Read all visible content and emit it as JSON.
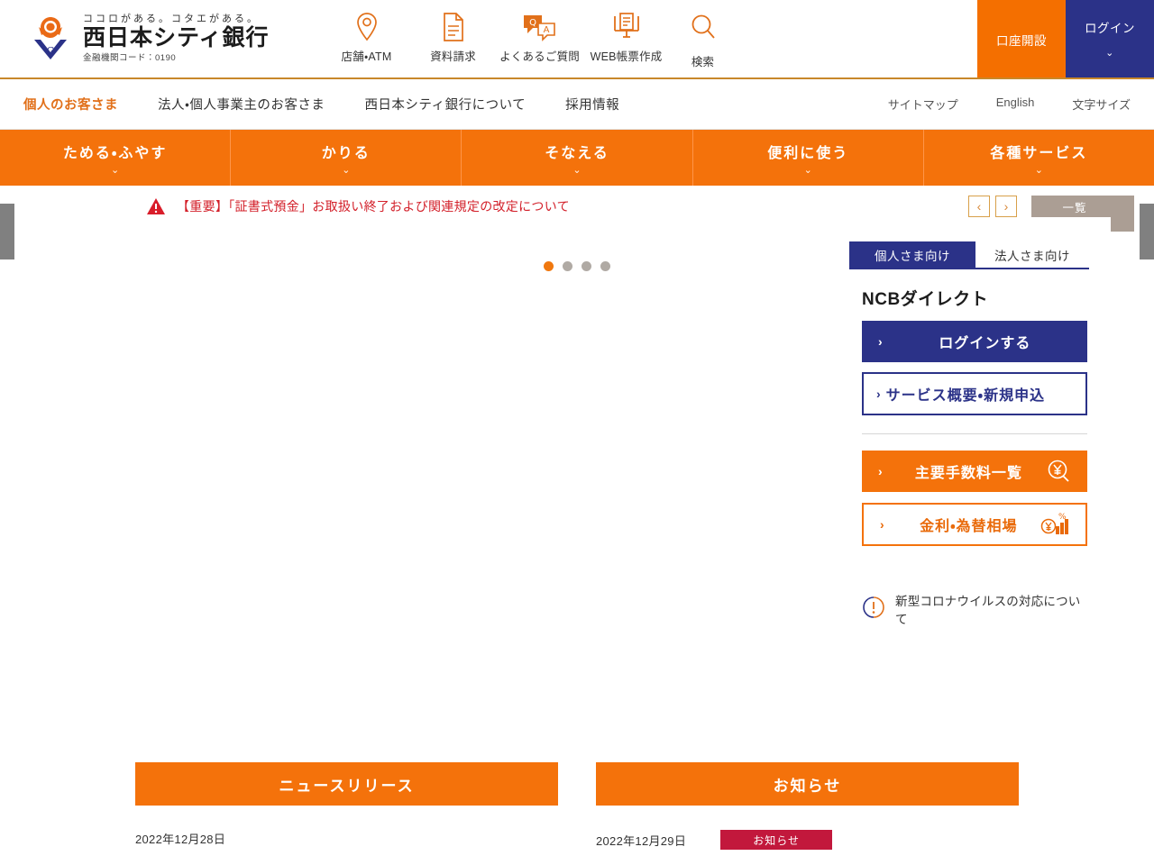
{
  "brand": {
    "tagline": "ココロがある。コタエがある。",
    "name": "西日本シティ銀行",
    "code": "金融機関コード：0190",
    "logo_icon": "flower-v-logo"
  },
  "header": {
    "icons": [
      {
        "label": "店舗・ATM",
        "icon": "map-pin-icon"
      },
      {
        "label": "資料請求",
        "icon": "document-icon"
      },
      {
        "label": "よくあるご質問",
        "icon": "qa-bubble-icon"
      },
      {
        "label": "WEB帳票作成",
        "icon": "web-form-icon"
      },
      {
        "label": "検索",
        "icon": "search-icon"
      }
    ],
    "cta_open_account": "口座開設",
    "cta_login": "ログイン",
    "cta_login_chevron": "⌄"
  },
  "gnav": {
    "items": [
      {
        "label": "個人のお客さま",
        "active": true
      },
      {
        "label": "法人・個人事業主のお客さま",
        "active": false
      },
      {
        "label": "西日本シティ銀行について",
        "active": false
      },
      {
        "label": "採用情報",
        "active": false
      }
    ],
    "utils": [
      "サイトマップ",
      "English",
      "文字サイズ"
    ]
  },
  "meganav": {
    "chevron": "⌄",
    "items": [
      "ためる・ふやす",
      "かりる",
      "そなえる",
      "便利に使う",
      "各種サービス"
    ]
  },
  "notice": {
    "warn_icon": "warning-triangle-icon",
    "text": "【重要】「証書式預金」お取扱い終了および関連規定の改定について",
    "prev": "‹",
    "next": "›",
    "list_label": "一覧"
  },
  "carousel": {
    "dot_count": 4,
    "active_index": 0
  },
  "sidepanel": {
    "tabs": [
      {
        "label": "個人さま向け",
        "active": true
      },
      {
        "label": "法人さま向け",
        "active": false
      }
    ],
    "title": "NCBダイレクト",
    "arrow": "›",
    "login_button": "ログインする",
    "service_button": "サービス概要・新規申込",
    "fees_button": "主要手数料一覧",
    "fees_icon": "yen-magnifier-icon",
    "rates_button": "金利・為替相場",
    "rates_icon": "yen-percent-chart-icon",
    "covid_icon": "exclamation-circle-icon",
    "covid_label": "新型コロナウイルスの対応について"
  },
  "news": {
    "columns": [
      {
        "heading": "ニュースリリース",
        "items": [
          {
            "date": "2022年12月28日",
            "badge": null
          }
        ]
      },
      {
        "heading": "お知らせ",
        "items": [
          {
            "date": "2022年12月29日",
            "badge": "お知らせ"
          }
        ]
      }
    ]
  },
  "colors": {
    "orange": "#f4720b",
    "navy": "#2b3288",
    "red": "#d3202a",
    "badge_red": "#c2183c",
    "tan": "#ab9e94",
    "gold_rule": "#c8882a"
  }
}
